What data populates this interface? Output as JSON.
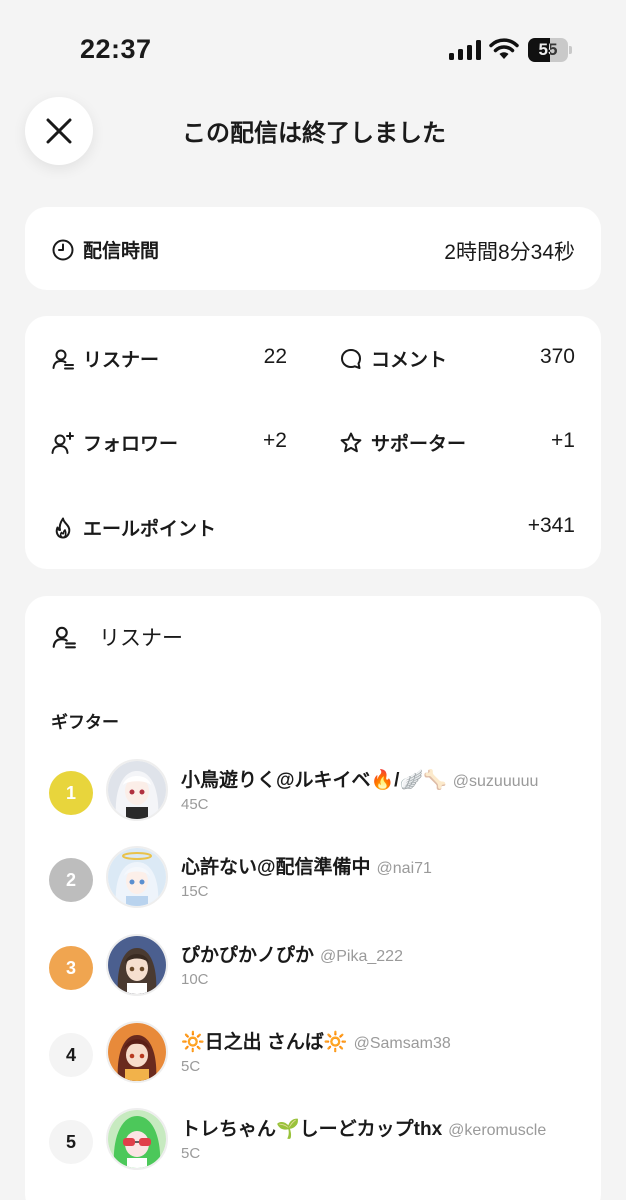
{
  "status_bar": {
    "time": "22:37",
    "battery": "55",
    "battery_level": 0.55
  },
  "header": {
    "title": "この配信は終了しました"
  },
  "duration": {
    "label": "配信時間",
    "value": "2時間8分34秒"
  },
  "stats": {
    "listeners": {
      "label": "リスナー",
      "value": "22"
    },
    "comments": {
      "label": "コメント",
      "value": "370"
    },
    "followers": {
      "label": "フォロワー",
      "value": "+2"
    },
    "supporters": {
      "label": "サポーター",
      "value": "+1"
    },
    "yell_points": {
      "label": "エールポイント",
      "value": "+341"
    }
  },
  "listeners_section": {
    "title": "リスナー",
    "gifter_label": "ギフター",
    "gifters": [
      {
        "rank": "1",
        "name": "小鳥遊りく@ルキイベ🔥/🪽🦴",
        "handle": "@suzuuuuu",
        "coins": "45C",
        "rank_color": "#e8d53c",
        "rank_text_color": "#ffffff"
      },
      {
        "rank": "2",
        "name": "心許ない@配信準備中",
        "handle": "@nai71",
        "coins": "15C",
        "rank_color": "#bdbdbd",
        "rank_text_color": "#ffffff"
      },
      {
        "rank": "3",
        "name": "ぴかぴかノぴか",
        "handle": "@Pika_222",
        "coins": "10C",
        "rank_color": "#f0a550",
        "rank_text_color": "#ffffff"
      },
      {
        "rank": "4",
        "name": "🔆日之出 さんば🔆",
        "handle": "@Samsam38",
        "coins": "5C",
        "rank_color": "#f4f4f4",
        "rank_text_color": "#1a1a1a"
      },
      {
        "rank": "5",
        "name": "トレちゃん🌱しーどカップthx",
        "handle": "@keromuscle",
        "coins": "5C",
        "rank_color": "#f4f4f4",
        "rank_text_color": "#1a1a1a"
      }
    ]
  }
}
